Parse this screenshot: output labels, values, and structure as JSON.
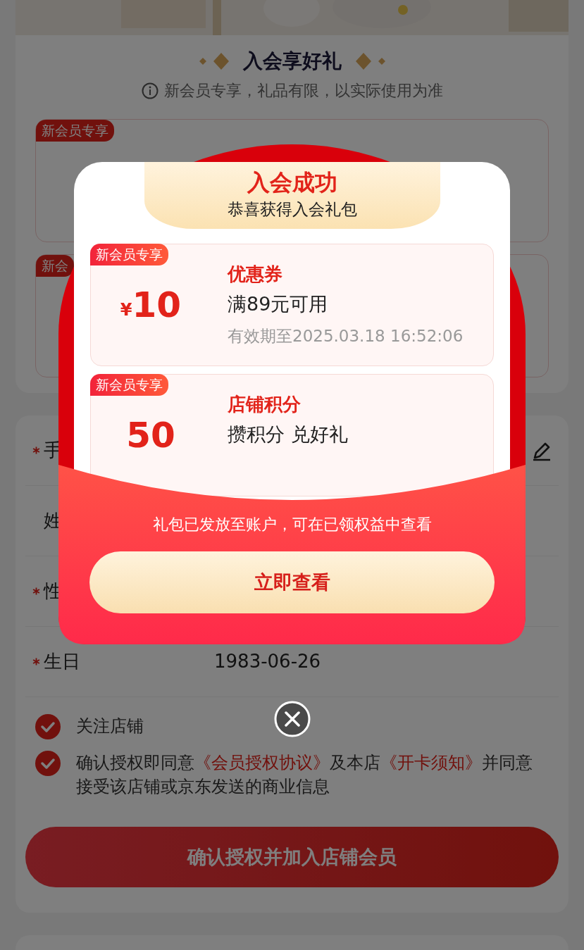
{
  "gifts_section": {
    "title": "入会享好礼",
    "notice": "新会员专享，礼品有限，以实际使用为准",
    "cards": [
      {
        "tag": "新会员专享"
      },
      {
        "tag": "新会"
      }
    ]
  },
  "form": {
    "fields": [
      {
        "kind": "editable",
        "label": "手",
        "required": true
      },
      {
        "kind": "text",
        "label": "姓",
        "required": false
      },
      {
        "kind": "text",
        "label": "性",
        "required": true
      },
      {
        "kind": "text",
        "label": "生日",
        "required": true,
        "value": "1983-06-26"
      }
    ]
  },
  "options": [
    {
      "kind": "plain",
      "checked": true,
      "text": "关注店铺"
    },
    {
      "kind": "agreement",
      "checked": true,
      "parts": [
        {
          "kind": "text",
          "text": "确认授权即同意"
        },
        {
          "kind": "link",
          "text": "《会员授权协议》"
        },
        {
          "kind": "text",
          "text": "及本店"
        },
        {
          "kind": "link",
          "text": "《开卡须知》"
        },
        {
          "kind": "text",
          "text": "并同意接受该店铺或京东发送的商业信息"
        }
      ]
    }
  ],
  "submit_button": "确认授权并加入店铺会员",
  "modal": {
    "title": "入会成功",
    "subtitle": "恭喜获得入会礼包",
    "gifts": [
      {
        "kind": "coupon",
        "tag": "新会员专享",
        "currency": "¥",
        "amount": "10",
        "name": "优惠券",
        "condition": "满89元可用",
        "validity": "有效期至2025.03.18 16:52:06"
      },
      {
        "kind": "points",
        "tag": "新会员专享",
        "amount": "50",
        "name": "店铺积分",
        "condition": "攒积分 兑好礼"
      }
    ],
    "notice": "礼包已发放至账户，可在已领权益中查看",
    "button": "立即查看"
  }
}
